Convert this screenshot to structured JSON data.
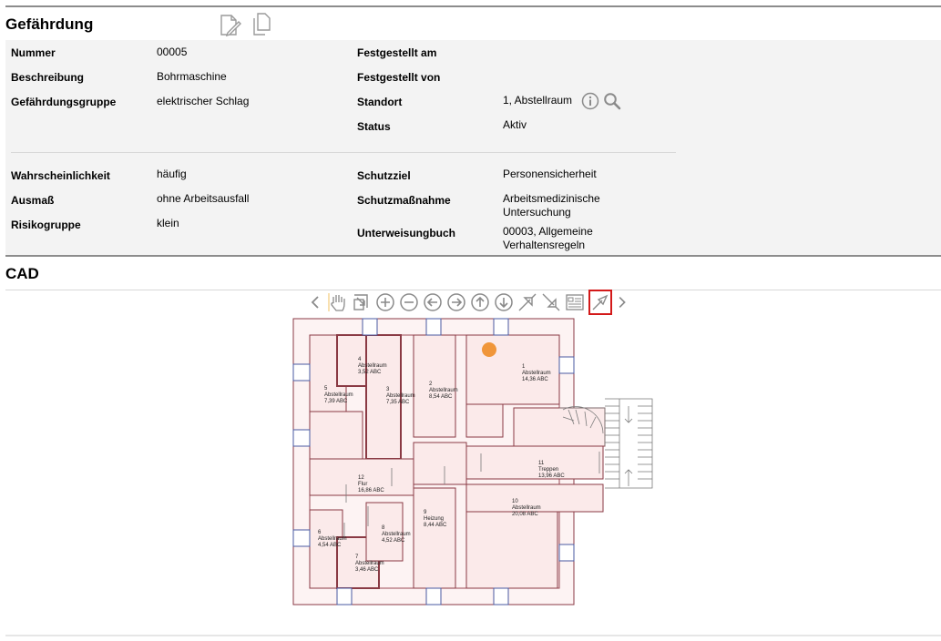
{
  "hazard": {
    "title": "Gefährdung",
    "edit_icon": "edit-document-icon",
    "copy_icon": "copy-document-icon",
    "fields_left": [
      {
        "label": "Nummer",
        "value": "00005"
      },
      {
        "label": "Beschreibung",
        "value": "Bohrmaschine"
      },
      {
        "label": "Gefährdungsgruppe",
        "value": "elektrischer Schlag"
      }
    ],
    "fields_right": [
      {
        "label": "Festgestellt am",
        "value": ""
      },
      {
        "label": "Festgestellt von",
        "value": ""
      },
      {
        "label": "Standort",
        "value": "1, Abstellraum"
      },
      {
        "label": "Status",
        "value": "Aktiv"
      }
    ],
    "risk_left": [
      {
        "label": "Wahrscheinlichkeit",
        "value": "häufig"
      },
      {
        "label": "Ausmaß",
        "value": "ohne Arbeitsausfall"
      },
      {
        "label": "Risikogruppe",
        "value": "klein"
      }
    ],
    "risk_right": [
      {
        "label": "Schutzziel",
        "value": "Personensicherheit"
      },
      {
        "label": "Schutzmaßnahme",
        "value": "Arbeitsmedizinische Untersuchung"
      },
      {
        "label": "Unterweisungbuch",
        "value": "00003, Allgemeine Verhaltensregeln"
      }
    ]
  },
  "cad": {
    "title": "CAD",
    "toolbar": [
      "chevron-left-icon",
      "pan-hand-icon",
      "zoom-window-icon",
      "zoom-in-icon",
      "zoom-out-icon",
      "pan-left-icon",
      "pan-right-icon",
      "pan-up-icon",
      "pan-down-icon",
      "zoom-extents-icon",
      "zoom-previous-icon",
      "legend-icon",
      "select-pointer-icon",
      "chevron-right-icon"
    ],
    "selected_tool": "select-pointer-icon",
    "rooms": [
      {
        "num": "1",
        "name": "Abstellraum",
        "area": "14,36 ABC"
      },
      {
        "num": "2",
        "name": "Abstellraum",
        "area": "8,54 ABC"
      },
      {
        "num": "3",
        "name": "Abstellraum",
        "area": "7,35 ABC"
      },
      {
        "num": "4",
        "name": "Abstellraum",
        "area": "3,52 ABC"
      },
      {
        "num": "5",
        "name": "Abstellraum",
        "area": "7,39 ABC"
      },
      {
        "num": "6",
        "name": "Abstellraum",
        "area": "4,54 ABC"
      },
      {
        "num": "7",
        "name": "Abstellraum",
        "area": "3,46 ABC"
      },
      {
        "num": "8",
        "name": "Abstellraum",
        "area": "4,52 ABC"
      },
      {
        "num": "9",
        "name": "Heizung",
        "area": "8,44 ABC"
      },
      {
        "num": "10",
        "name": "Abstellraum",
        "area": "20,08 ABC"
      },
      {
        "num": "11",
        "name": "Treppen",
        "area": "13,96 ABC"
      },
      {
        "num": "12",
        "name": "Flur",
        "area": "16,86 ABC"
      }
    ],
    "marker_color": "#f0963a",
    "accent_border": "#7a1f2b",
    "selection_color": "#d31919"
  }
}
